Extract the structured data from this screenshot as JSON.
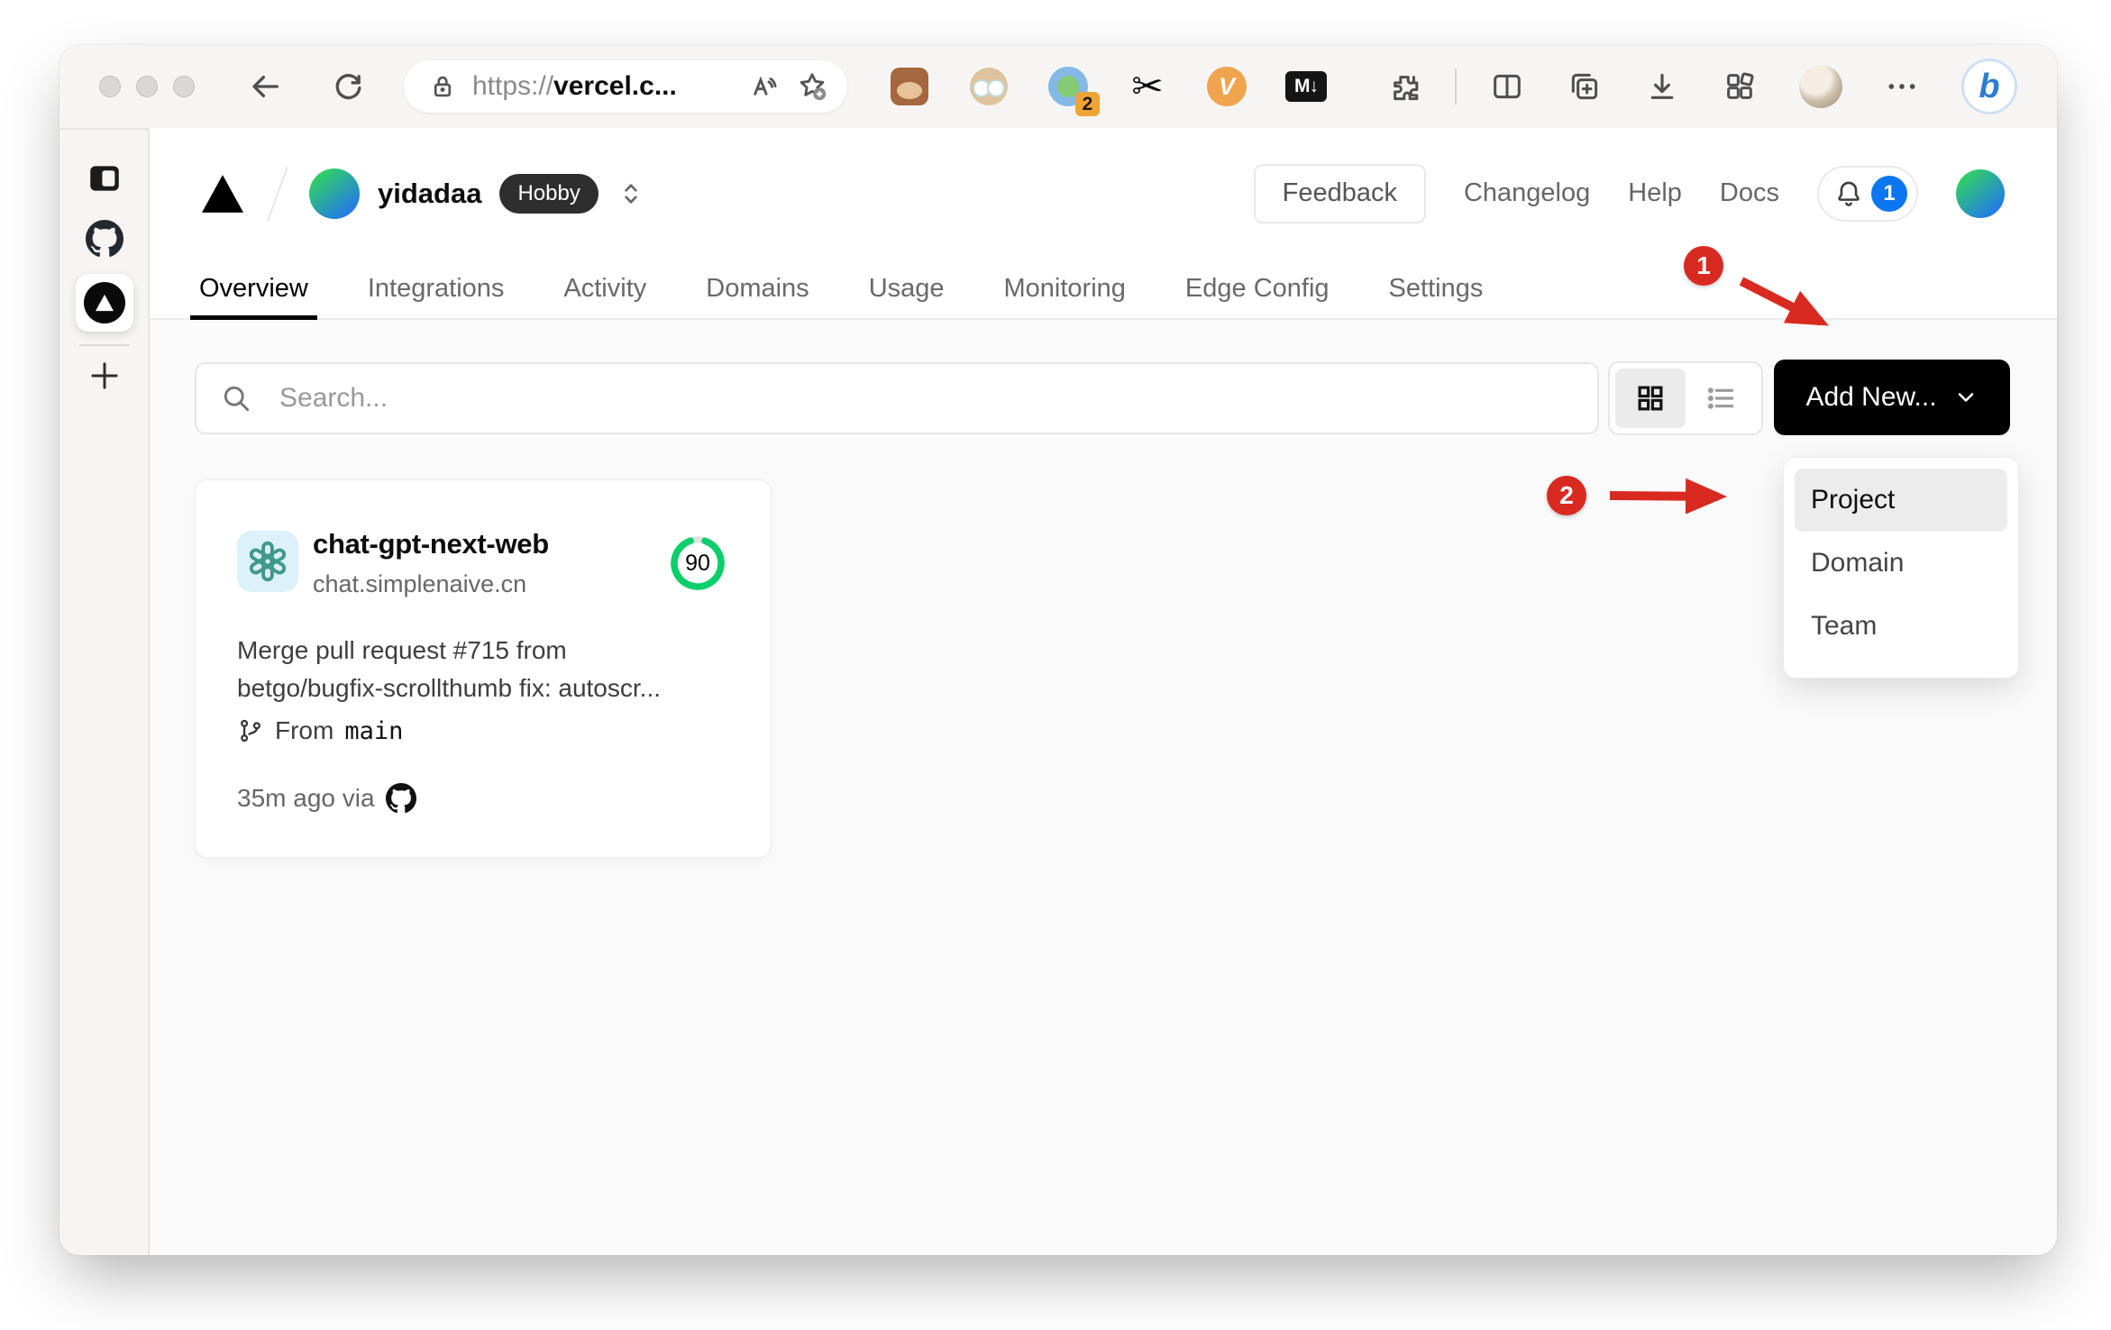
{
  "browser": {
    "url_scheme": "https://",
    "url_host": "vercel.c...",
    "proxy_badge": "2",
    "scissors_glyph": "✂",
    "v_ext_label": "V",
    "md_ext_label": "M↓",
    "bing_label": "b"
  },
  "vercel": {
    "team": "yidadaa",
    "plan": "Hobby",
    "feedback": "Feedback",
    "nav_links": [
      {
        "label": "Changelog"
      },
      {
        "label": "Help"
      },
      {
        "label": "Docs"
      }
    ],
    "notification_count": "1",
    "tabs": [
      {
        "label": "Overview",
        "active": true
      },
      {
        "label": "Integrations"
      },
      {
        "label": "Activity"
      },
      {
        "label": "Domains"
      },
      {
        "label": "Usage"
      },
      {
        "label": "Monitoring"
      },
      {
        "label": "Edge Config"
      },
      {
        "label": "Settings"
      }
    ],
    "search_placeholder": "Search...",
    "add_new": "Add New...",
    "dropdown": [
      {
        "label": "Project",
        "highlighted": true
      },
      {
        "label": "Domain"
      },
      {
        "label": "Team"
      }
    ],
    "card": {
      "name": "chat-gpt-next-web",
      "domain": "chat.simplenaive.cn",
      "score": "90",
      "commit_line1": "Merge pull request #715 from",
      "commit_line2": "betgo/bugfix-scrollthumb fix: autoscr...",
      "branch_word": "From",
      "branch_name": "main",
      "deployed": "35m ago via"
    }
  },
  "annotations": {
    "step1": "1",
    "step2": "2"
  },
  "colors": {
    "annotation_red": "#d92a21",
    "score_green": "#0cce6b",
    "notification_blue": "#0b76ef",
    "openai_teal": "#419a88",
    "accent_black": "#000000"
  }
}
